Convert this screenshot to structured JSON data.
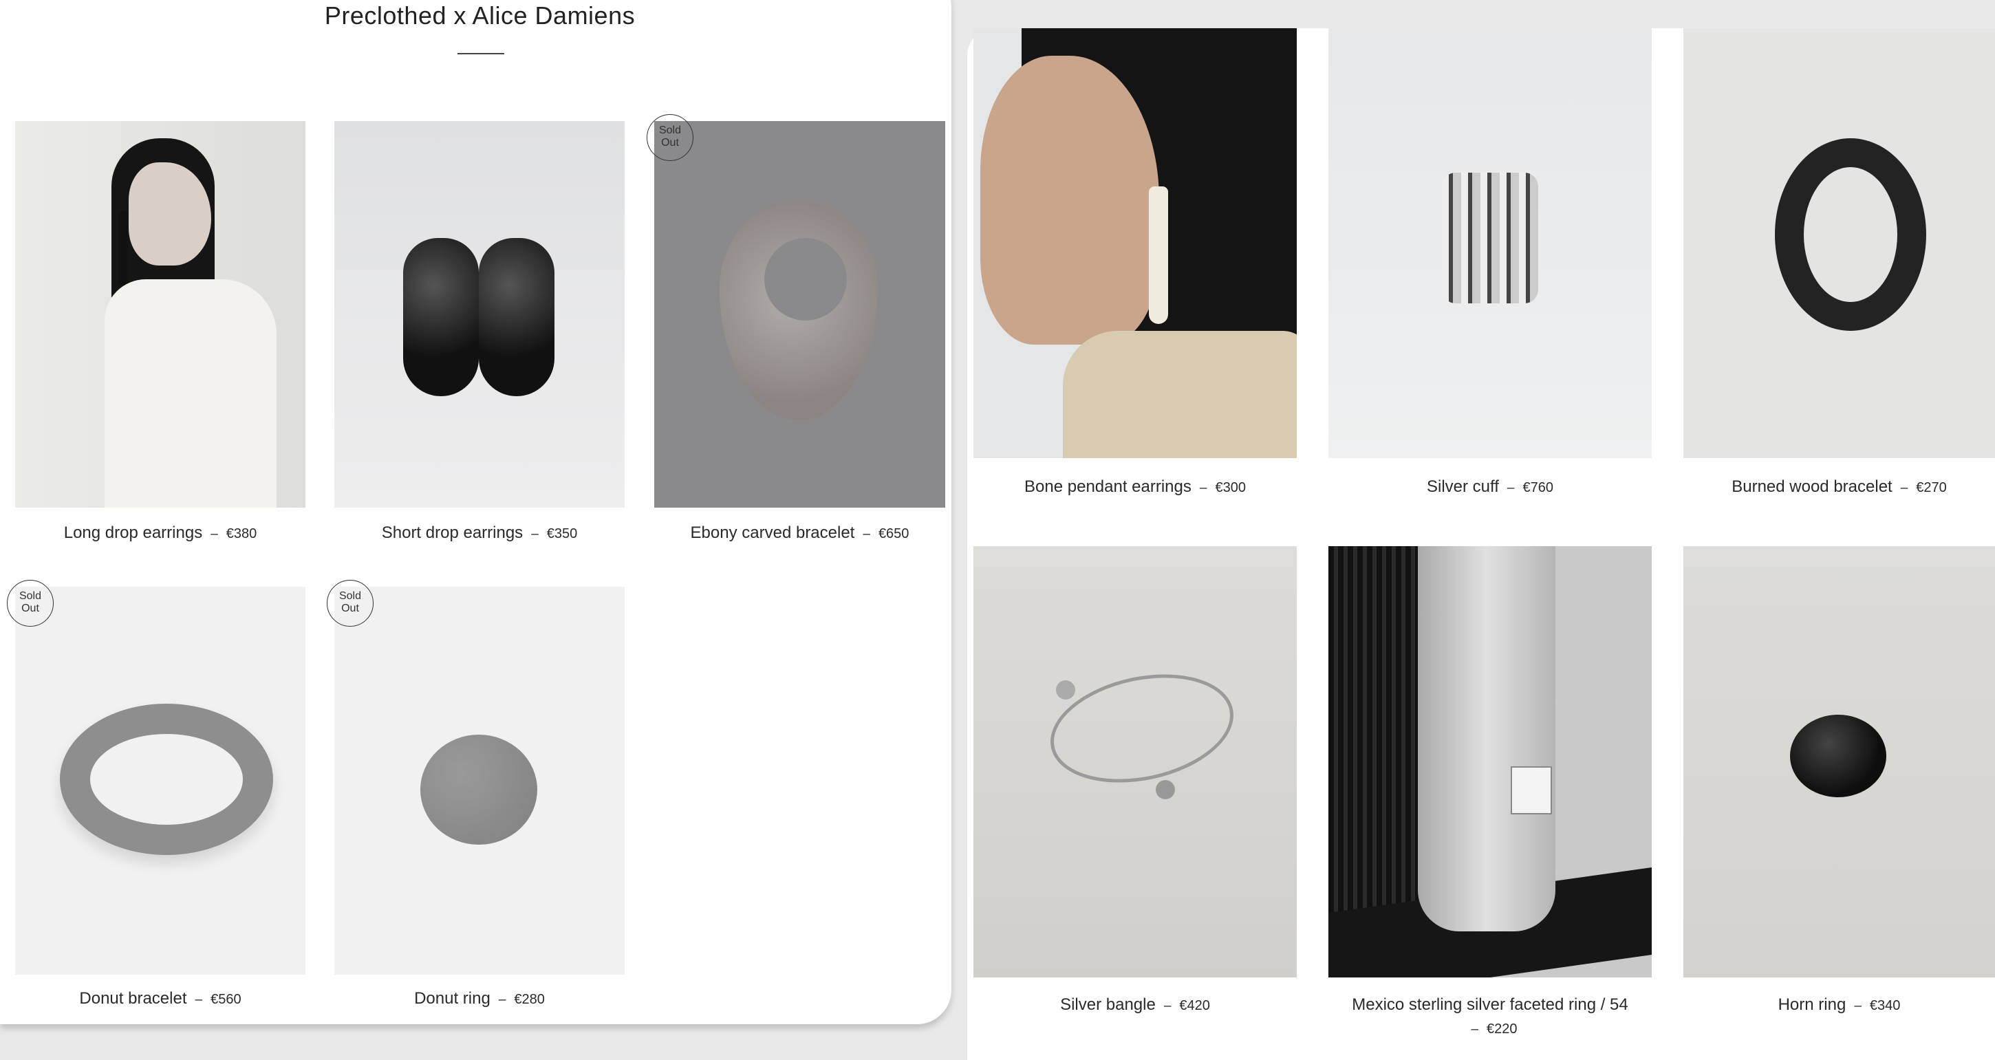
{
  "collection": {
    "title": "Preclothed x Alice Damiens",
    "sold_out_label_1": "Sold",
    "sold_out_label_2": "Out",
    "separator": "–",
    "products": [
      {
        "name": "Long drop earrings",
        "price": "€380",
        "sold_out": false
      },
      {
        "name": "Short drop earrings",
        "price": "€350",
        "sold_out": false
      },
      {
        "name": "Ebony carved bracelet",
        "price": "€650",
        "sold_out": true
      },
      {
        "name": "Donut bracelet",
        "price": "€560",
        "sold_out": true
      },
      {
        "name": "Donut ring",
        "price": "€280",
        "sold_out": true
      }
    ]
  },
  "shop": {
    "separator": "–",
    "products": [
      {
        "name": "Bone pendant earrings",
        "price": "€300"
      },
      {
        "name": "Silver cuff",
        "price": "€760"
      },
      {
        "name": "Burned wood bracelet",
        "price": "€270"
      },
      {
        "name": "Silver bangle",
        "price": "€420"
      },
      {
        "name": "Mexico sterling silver faceted ring / 54",
        "price": "€220"
      },
      {
        "name": "Horn ring",
        "price": "€340"
      }
    ]
  }
}
